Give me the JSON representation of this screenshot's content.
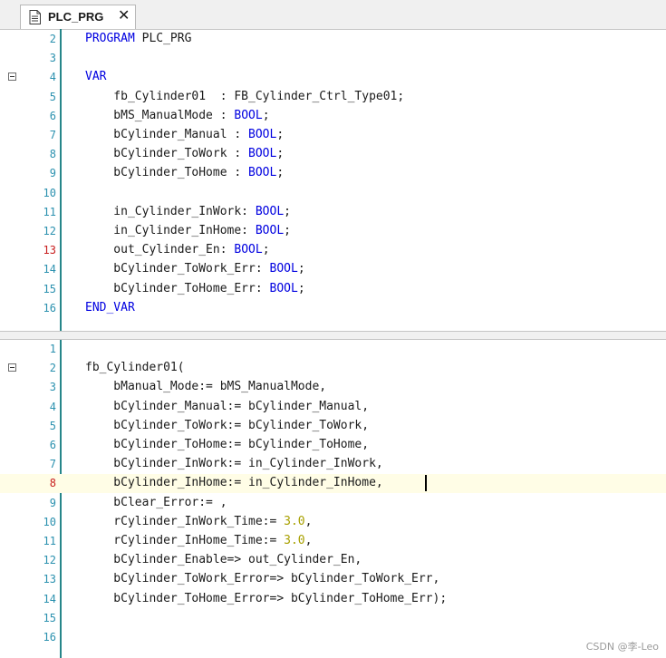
{
  "tab": {
    "title": "PLC_PRG",
    "close_glyph": "✕",
    "icon": "document-icon"
  },
  "declaration": {
    "lines": [
      {
        "n": "2",
        "fold": false,
        "mod": false,
        "tokens": [
          [
            "kw",
            "PROGRAM"
          ],
          [
            "",
            " PLC_PRG"
          ]
        ]
      },
      {
        "n": "3",
        "fold": false,
        "mod": false,
        "tokens": []
      },
      {
        "n": "4",
        "fold": true,
        "mod": false,
        "tokens": [
          [
            "kw",
            "VAR"
          ]
        ]
      },
      {
        "n": "5",
        "fold": false,
        "mod": false,
        "tokens": [
          [
            "",
            "    fb_Cylinder01  : FB_Cylinder_Ctrl_Type01;"
          ]
        ]
      },
      {
        "n": "6",
        "fold": false,
        "mod": false,
        "tokens": [
          [
            "",
            "    bMS_ManualMode : "
          ],
          [
            "kw",
            "BOOL"
          ],
          [
            "",
            ";"
          ]
        ]
      },
      {
        "n": "7",
        "fold": false,
        "mod": false,
        "tokens": [
          [
            "",
            "    bCylinder_Manual : "
          ],
          [
            "kw",
            "BOOL"
          ],
          [
            "",
            ";"
          ]
        ]
      },
      {
        "n": "8",
        "fold": false,
        "mod": false,
        "tokens": [
          [
            "",
            "    bCylinder_ToWork : "
          ],
          [
            "kw",
            "BOOL"
          ],
          [
            "",
            ";"
          ]
        ]
      },
      {
        "n": "9",
        "fold": false,
        "mod": false,
        "tokens": [
          [
            "",
            "    bCylinder_ToHome : "
          ],
          [
            "kw",
            "BOOL"
          ],
          [
            "",
            ";"
          ]
        ]
      },
      {
        "n": "10",
        "fold": false,
        "mod": false,
        "tokens": []
      },
      {
        "n": "11",
        "fold": false,
        "mod": false,
        "tokens": [
          [
            "",
            "    in_Cylinder_InWork: "
          ],
          [
            "kw",
            "BOOL"
          ],
          [
            "",
            ";"
          ]
        ]
      },
      {
        "n": "12",
        "fold": false,
        "mod": false,
        "tokens": [
          [
            "",
            "    in_Cylinder_InHome: "
          ],
          [
            "kw",
            "BOOL"
          ],
          [
            "",
            ";"
          ]
        ]
      },
      {
        "n": "13",
        "fold": false,
        "mod": true,
        "tokens": [
          [
            "",
            "    out_Cylinder_En: "
          ],
          [
            "kw",
            "BOOL"
          ],
          [
            "",
            ";"
          ]
        ]
      },
      {
        "n": "14",
        "fold": false,
        "mod": false,
        "tokens": [
          [
            "",
            "    bCylinder_ToWork_Err: "
          ],
          [
            "kw",
            "BOOL"
          ],
          [
            "",
            ";"
          ]
        ]
      },
      {
        "n": "15",
        "fold": false,
        "mod": false,
        "tokens": [
          [
            "",
            "    bCylinder_ToHome_Err: "
          ],
          [
            "kw",
            "BOOL"
          ],
          [
            "",
            ";"
          ]
        ]
      },
      {
        "n": "16",
        "fold": false,
        "mod": false,
        "tokens": [
          [
            "kw",
            "END_VAR"
          ]
        ]
      }
    ]
  },
  "implementation": {
    "lines": [
      {
        "n": "1",
        "fold": false,
        "mod": false,
        "tokens": []
      },
      {
        "n": "2",
        "fold": true,
        "mod": false,
        "tokens": [
          [
            "",
            "fb_Cylinder01("
          ]
        ]
      },
      {
        "n": "3",
        "fold": false,
        "mod": false,
        "tokens": [
          [
            "",
            "    bManual_Mode:= bMS_ManualMode,"
          ]
        ]
      },
      {
        "n": "4",
        "fold": false,
        "mod": false,
        "tokens": [
          [
            "",
            "    bCylinder_Manual:= bCylinder_Manual,"
          ]
        ]
      },
      {
        "n": "5",
        "fold": false,
        "mod": false,
        "tokens": [
          [
            "",
            "    bCylinder_ToWork:= bCylinder_ToWork,"
          ]
        ]
      },
      {
        "n": "6",
        "fold": false,
        "mod": false,
        "tokens": [
          [
            "",
            "    bCylinder_ToHome:= bCylinder_ToHome,"
          ]
        ]
      },
      {
        "n": "7",
        "fold": false,
        "mod": false,
        "tokens": [
          [
            "",
            "    bCylinder_InWork:= in_Cylinder_InWork,"
          ]
        ]
      },
      {
        "n": "8",
        "fold": false,
        "mod": true,
        "current": true,
        "tokens": [
          [
            "",
            "    bCylinder_InHome:= in_Cylinder_InHome,"
          ]
        ]
      },
      {
        "n": "9",
        "fold": false,
        "mod": false,
        "tokens": [
          [
            "",
            "    bClear_Error:= ,"
          ]
        ]
      },
      {
        "n": "10",
        "fold": false,
        "mod": false,
        "tokens": [
          [
            "",
            "    rCylinder_InWork_Time:= "
          ],
          [
            "num",
            "3.0"
          ],
          [
            "",
            ","
          ]
        ]
      },
      {
        "n": "11",
        "fold": false,
        "mod": false,
        "tokens": [
          [
            "",
            "    rCylinder_InHome_Time:= "
          ],
          [
            "num",
            "3.0"
          ],
          [
            "",
            ","
          ]
        ]
      },
      {
        "n": "12",
        "fold": false,
        "mod": false,
        "tokens": [
          [
            "",
            "    bCylinder_Enable=> out_Cylinder_En,"
          ]
        ]
      },
      {
        "n": "13",
        "fold": false,
        "mod": false,
        "tokens": [
          [
            "",
            "    bCylinder_ToWork_Error=> bCylinder_ToWork_Err,"
          ]
        ]
      },
      {
        "n": "14",
        "fold": false,
        "mod": false,
        "tokens": [
          [
            "",
            "    bCylinder_ToHome_Error=> bCylinder_ToHome_Err);"
          ]
        ]
      },
      {
        "n": "15",
        "fold": false,
        "mod": false,
        "tokens": []
      },
      {
        "n": "16",
        "fold": false,
        "mod": false,
        "tokens": []
      }
    ]
  },
  "watermark": "CSDN @李-Leo"
}
